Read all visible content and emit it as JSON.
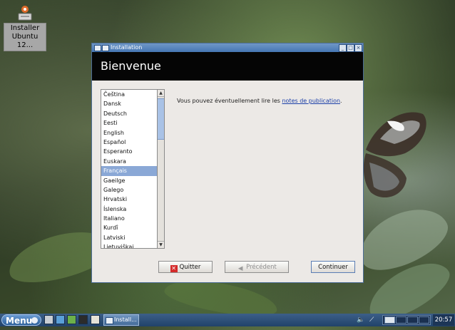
{
  "desktop": {
    "icon_label_line1": "Installer",
    "icon_label_line2": "Ubuntu 12..."
  },
  "window": {
    "title": "Installation",
    "heading": "Bienvenue",
    "languages": [
      "Čeština",
      "Dansk",
      "Deutsch",
      "Eesti",
      "English",
      "Español",
      "Esperanto",
      "Euskara",
      "Français",
      "Gaeilge",
      "Galego",
      "Hrvatski",
      "Íslenska",
      "Italiano",
      "Kurdî",
      "Latviski",
      "Lietuviškai"
    ],
    "selected_language": "Français",
    "notice_text": "Vous pouvez éventuellement lire les ",
    "notice_link": "notes de publication",
    "notice_end": ".",
    "buttons": {
      "quit": "Quitter",
      "back": "Précédent",
      "continue": "Continuer"
    }
  },
  "taskbar": {
    "menu_label": "Menu",
    "task_label": "Install...",
    "clock": "20:57"
  },
  "colors": {
    "titlebar": "#4677b4",
    "selection": "#8aa8d6",
    "taskbar": "#21426a"
  }
}
